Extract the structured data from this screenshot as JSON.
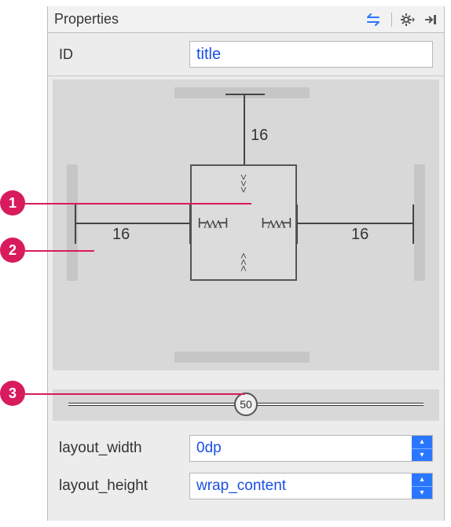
{
  "panel": {
    "title": "Properties",
    "id_label": "ID",
    "id_value": "title"
  },
  "constraints": {
    "margin_top": "16",
    "margin_left": "16",
    "margin_right": "16",
    "bias": "50"
  },
  "fields": {
    "layout_width": {
      "label": "layout_width",
      "value": "0dp"
    },
    "layout_height": {
      "label": "layout_height",
      "value": "wrap_content"
    }
  },
  "callouts": {
    "c1": "1",
    "c2": "2",
    "c3": "3"
  }
}
